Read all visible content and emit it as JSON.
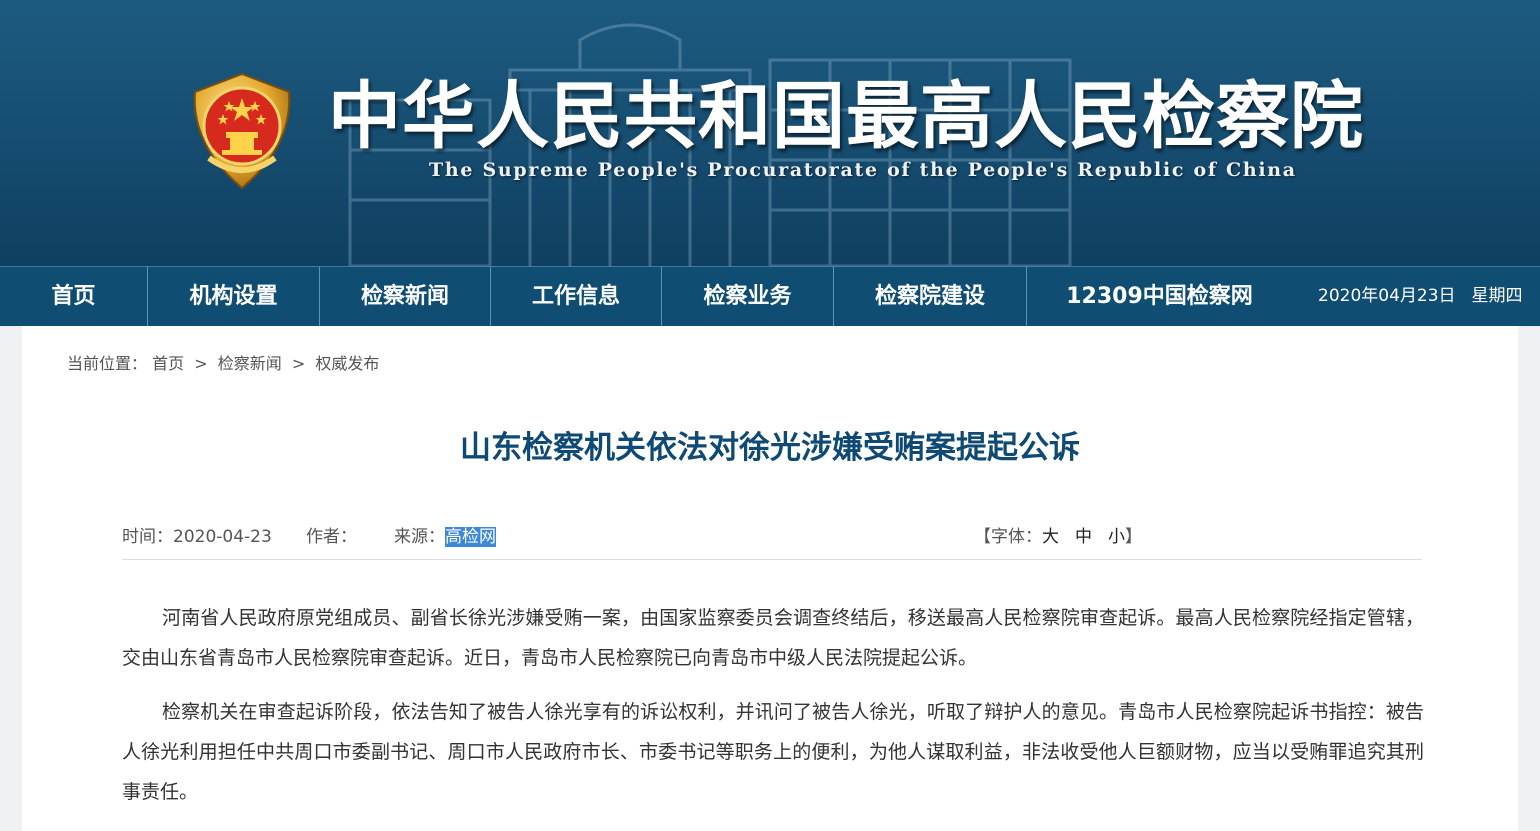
{
  "banner": {
    "title": "中华人民共和国最高人民检察院",
    "subtitle": "The Supreme People's Procuratorate of the People's Republic of China"
  },
  "nav": {
    "items": [
      {
        "label": "首页"
      },
      {
        "label": "机构设置"
      },
      {
        "label": "检察新闻"
      },
      {
        "label": "工作信息"
      },
      {
        "label": "检察业务"
      },
      {
        "label": "检察院建设"
      },
      {
        "label": "12309中国检察网"
      }
    ],
    "date": "2020年04月23日",
    "weekday": "星期四"
  },
  "breadcrumb": {
    "prefix": "当前位置：",
    "items": [
      "首页",
      "检察新闻",
      "权威发布"
    ],
    "separator": ">"
  },
  "article": {
    "title": "山东检察机关依法对徐光涉嫌受贿案提起公诉",
    "meta": {
      "time": "时间：2020-04-23",
      "author": "作者：",
      "source_label": "来源：",
      "source_value": "高检网",
      "font_label": "【字体：",
      "font_large": "大",
      "font_medium": "中",
      "font_small": "小",
      "font_end": "】"
    },
    "paragraphs": [
      "河南省人民政府原党组成员、副省长徐光涉嫌受贿一案，由国家监察委员会调查终结后，移送最高人民检察院审查起诉。最高人民检察院经指定管辖，交由山东省青岛市人民检察院审查起诉。近日，青岛市人民检察院已向青岛市中级人民法院提起公诉。",
      "检察机关在审查起诉阶段，依法告知了被告人徐光享有的诉讼权利，并讯问了被告人徐光，听取了辩护人的意见。青岛市人民检察院起诉书指控：被告人徐光利用担任中共周口市委副书记、周口市人民政府市长、市委书记等职务上的便利，为他人谋取利益，非法收受他人巨额财物，应当以受贿罪追究其刑事责任。"
    ]
  },
  "colors": {
    "banner": "#174f73",
    "nav": "#0f4d72",
    "title": "#0f4a74",
    "selection": "#3c87d6"
  },
  "icons": [
    "procuratorate-emblem-icon",
    "building-watermark"
  ]
}
